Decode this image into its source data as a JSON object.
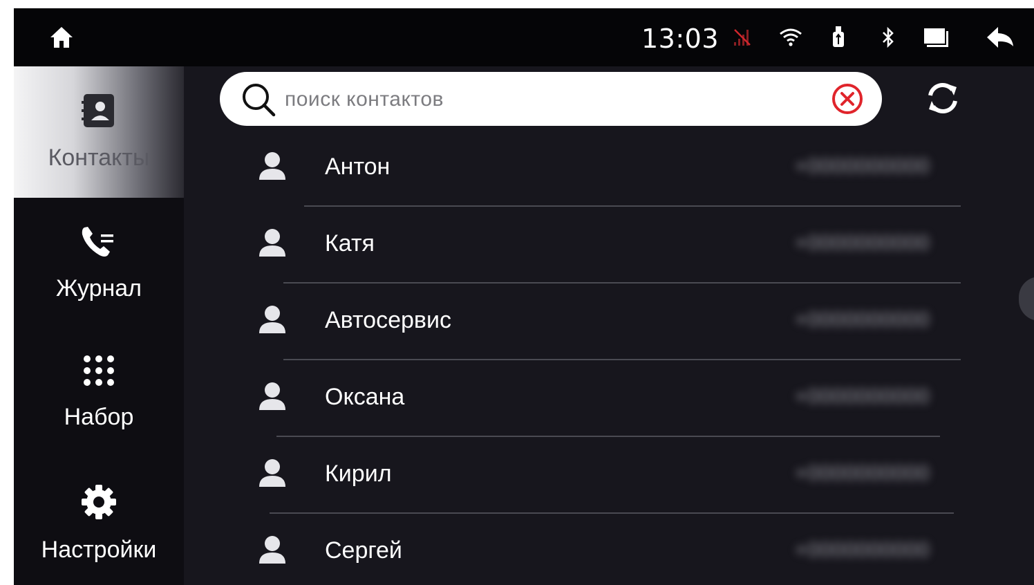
{
  "status_bar": {
    "time": "13:03",
    "icons": [
      "home-icon",
      "no-signal-icon",
      "wifi-icon",
      "usb-icon",
      "bluetooth-icon",
      "screen-icon",
      "back-icon"
    ]
  },
  "sidebar": {
    "items": [
      {
        "label": "Контакты",
        "icon": "contacts-book-icon",
        "active": true
      },
      {
        "label": "Журнал",
        "icon": "call-log-icon",
        "active": false
      },
      {
        "label": "Набор",
        "icon": "dialpad-icon",
        "active": false
      },
      {
        "label": "Настройки",
        "icon": "settings-gear-icon",
        "active": false
      }
    ]
  },
  "search": {
    "placeholder": "поиск контактов",
    "value": ""
  },
  "contacts": [
    {
      "name": "Антон"
    },
    {
      "name": "Катя"
    },
    {
      "name": "Автосервис"
    },
    {
      "name": "Оксана"
    },
    {
      "name": "Кирил"
    },
    {
      "name": "Сергей"
    }
  ],
  "colors": {
    "background": "#17161d",
    "status_bar": "#050507",
    "sidebar": "#0e0d12",
    "clear_button": "#e0242b",
    "text": "#ffffff"
  }
}
